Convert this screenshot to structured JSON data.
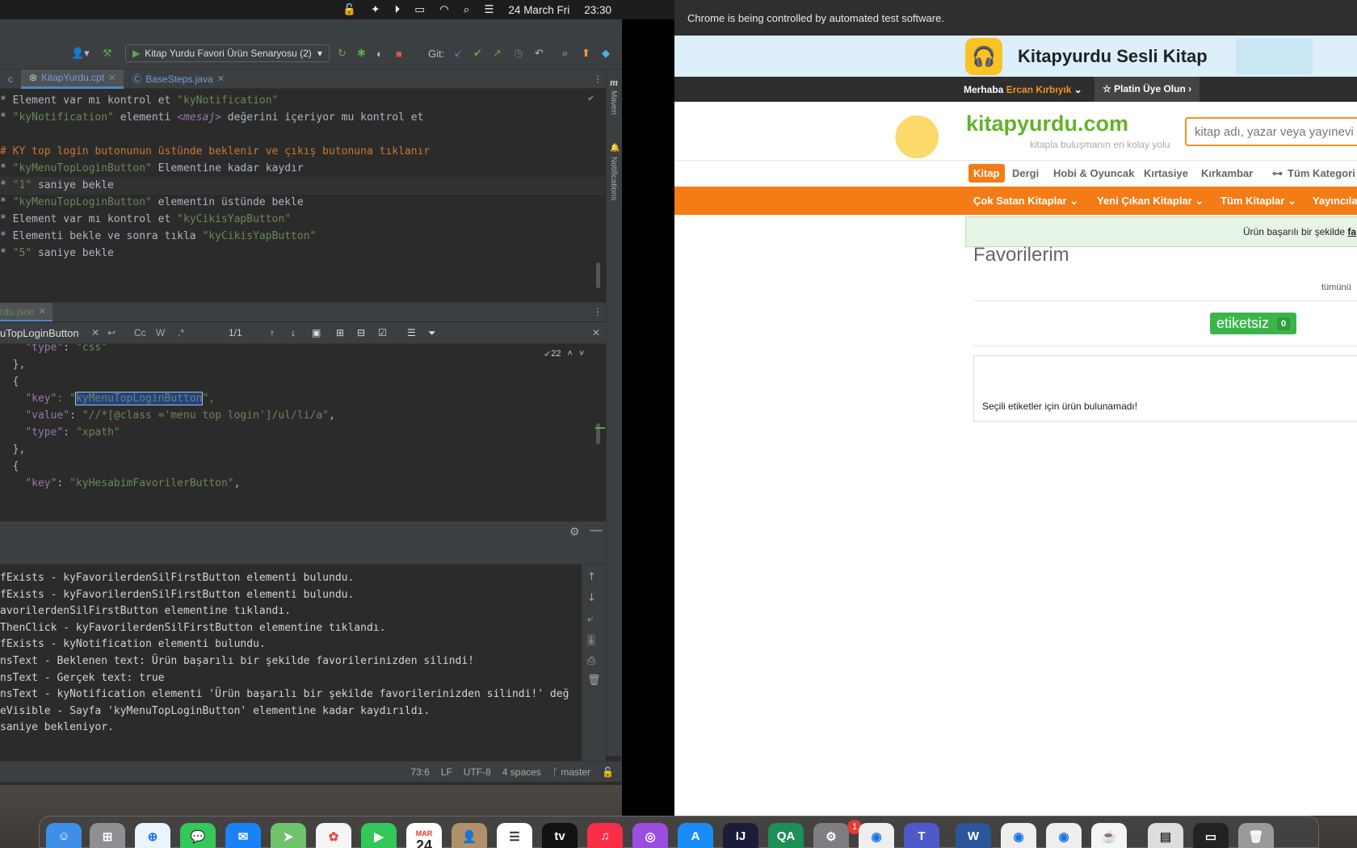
{
  "menubar": {
    "date": "24 March Fri",
    "time": "23:30"
  },
  "ide": {
    "run_config": "Kitap Yurdu Favori Ürün Senaryosu (2)",
    "git_label": "Git:",
    "tabs": [
      {
        "label": "c"
      },
      {
        "label": "KitapYurdu.cpt"
      },
      {
        "label": "BaseSteps.java"
      }
    ],
    "side_labels": {
      "maven": "Maven",
      "notifications": "Notifications"
    },
    "spec_lines": [
      {
        "prefix": "* ",
        "parts": [
          {
            "t": "Element var mı kontrol et ",
            "c": "pl"
          },
          {
            "t": "\"kyNotification\"",
            "c": "str"
          }
        ]
      },
      {
        "prefix": "* ",
        "parts": [
          {
            "t": "\"kyNotification\"",
            "c": "str"
          },
          {
            "t": " elementi ",
            "c": "pl"
          },
          {
            "t": "<mesaj>",
            "c": "it"
          },
          {
            "t": " değerini içeriyor mu kontrol et",
            "c": "pl"
          }
        ]
      },
      {
        "prefix": "",
        "parts": []
      },
      {
        "prefix": "# ",
        "parts": [
          {
            "t": "KY top login butonunun üstünde beklenir ve çıkış butonuna tıklanır",
            "c": "kw"
          }
        ]
      },
      {
        "prefix": "* ",
        "parts": [
          {
            "t": "\"kyMenuTopLoginButton\"",
            "c": "str"
          },
          {
            "t": " Elementine kadar kaydır",
            "c": "pl"
          }
        ]
      },
      {
        "prefix": "* ",
        "parts": [
          {
            "t": "\"1\"",
            "c": "str"
          },
          {
            "t": " saniye bekle",
            "c": "pl"
          }
        ]
      },
      {
        "prefix": "* ",
        "parts": [
          {
            "t": "\"kyMenuTopLoginButton\"",
            "c": "str"
          },
          {
            "t": " elementin üstünde bekle",
            "c": "pl"
          }
        ]
      },
      {
        "prefix": "* ",
        "parts": [
          {
            "t": "Element var mı kontrol et ",
            "c": "pl"
          },
          {
            "t": "\"kyCikisYapButton\"",
            "c": "str"
          }
        ]
      },
      {
        "prefix": "* ",
        "parts": [
          {
            "t": "Elementi bekle ve sonra tıkla ",
            "c": "pl"
          },
          {
            "t": "\"kyCikisYapButton\"",
            "c": "str"
          }
        ]
      },
      {
        "prefix": "* ",
        "parts": [
          {
            "t": "\"5\"",
            "c": "str"
          },
          {
            "t": " saniye bekle",
            "c": "pl"
          }
        ]
      }
    ],
    "json_tab": "rdu.json",
    "search_query": "uTopLoginButton",
    "search_count": "1/1",
    "match_count": "22",
    "json_lines": [
      {
        "indent": "    ",
        "key": "\"type\"",
        "sep": ": ",
        "val": "\"css\"",
        "tail": ""
      },
      {
        "indent": "  ",
        "key": "",
        "sep": "",
        "val": "",
        "tail": "},"
      },
      {
        "indent": "  ",
        "key": "",
        "sep": "",
        "val": "",
        "tail": "{"
      },
      {
        "indent": "    ",
        "key": "\"key\"",
        "sep": ": \"",
        "val": "kyMenuTopLoginButton",
        "tail": "\",",
        "selected": true
      },
      {
        "indent": "    ",
        "key": "\"value\"",
        "sep": ": ",
        "val": "\"//*[@class ='menu top login']/ul/li/a\"",
        "tail": ","
      },
      {
        "indent": "    ",
        "key": "\"type\"",
        "sep": ": ",
        "val": "\"xpath\"",
        "tail": ""
      },
      {
        "indent": "  ",
        "key": "",
        "sep": "",
        "val": "",
        "tail": "},"
      },
      {
        "indent": "  ",
        "key": "",
        "sep": "",
        "val": "",
        "tail": "{"
      },
      {
        "indent": "    ",
        "key": "\"key\"",
        "sep": ": ",
        "val": "\"kyHesabimFavorilerButton\"",
        "tail": ","
      }
    ],
    "console_lines": [
      "fExists - kyFavorilerdenSilFirstButton elementi bulundu.",
      "fExists - kyFavorilerdenSilFirstButton elementi bulundu.",
      "avorilerdenSilFirstButton elementine tıklandı.",
      "ThenClick - kyFavorilerdenSilFirstButton elementine tıklandı.",
      "fExists - kyNotification elementi bulundu.",
      "nsText - Beklenen text: Ürün başarılı bir şekilde favorilerinizden silindi!",
      "nsText - Gerçek text: true",
      "nsText - kyNotification elementi 'Ürün başarılı bir şekilde favorilerinizden silindi!' değ",
      "eVisible - Sayfa 'kyMenuTopLoginButton' elementine kadar kaydırıldı.",
      "saniye bekleniyor."
    ],
    "status": {
      "position": "73:6",
      "line_sep": "LF",
      "encoding": "UTF-8",
      "indent": "4 spaces",
      "branch": "master"
    }
  },
  "browser": {
    "automation_notice": "Chrome is being controlled by automated test software.",
    "banner_title": "Kitapyurdu Sesli Kitap",
    "user_greeting": "Merhaba",
    "user_name": "Ercan Kırbıyık",
    "platinum": "Platin Üye Olun",
    "logo": "kitapyurdu.com",
    "logo_tagline": "kitapla buluşmanın en kolay yolu",
    "search_placeholder": "kitap adı, yazar veya yayınevi ara",
    "categories": [
      "Kitap",
      "Dergi",
      "Hobi & Oyuncak",
      "Kırtasiye",
      "Kırkambar",
      "Tüm Kategori"
    ],
    "orange_menu": [
      "Çok Satan Kitaplar",
      "Yeni Çıkan Kitaplar",
      "Tüm Kitaplar",
      "Yayıncıla"
    ],
    "notification_text": "Ürün başarılı bir şekilde",
    "notification_link": "fa",
    "page_title": "Favorilerim",
    "all_link": "tümünü",
    "tag_label": "etiketsiz",
    "tag_count": "0",
    "empty_message": "Seçili etiketler için ürün bulunamadı!"
  },
  "dock": {
    "calendar_month": "MAR",
    "calendar_day": "24",
    "notification_badge": "1"
  },
  "colors": {
    "accent_orange": "#f37c16",
    "brand_green": "#64b32a",
    "tag_green": "#3bb54a",
    "ide_bg": "#2b2b2b"
  }
}
